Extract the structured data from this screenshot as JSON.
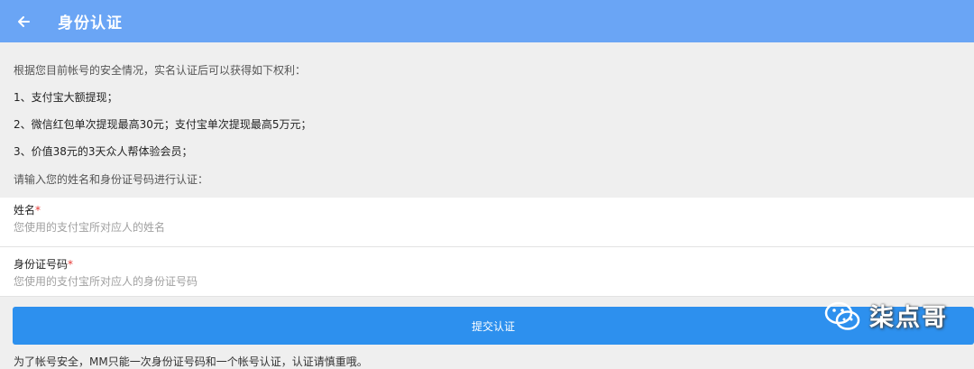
{
  "header": {
    "title": "身份认证",
    "back_icon": "arrow-left-icon",
    "background": "#6aa5f5"
  },
  "intro": {
    "lead": "根据您目前帐号的安全情况，实名认证后可以获得如下权利：",
    "benefits": [
      "1、支付宝大额提现；",
      "2、微信红包单次提现最高30元；支付宝单次提现最高5万元；",
      "3、价值38元的3天众人帮体验会员；"
    ],
    "hint": "请输入您的姓名和身份证号码进行认证："
  },
  "form": {
    "name": {
      "label": "姓名",
      "required_mark": "*",
      "placeholder": "您使用的支付宝所对应人的姓名"
    },
    "id_number": {
      "label": "身份证号码",
      "required_mark": "*",
      "placeholder": "您使用的支付宝所对应人的身份证号码"
    }
  },
  "submit_label": "提交认证",
  "submit_color": "#2d90ee",
  "footer_text": "为了帐号安全，MM只能一次身份证号码和一个帐号认证，认证请慎重哦。",
  "watermark": {
    "text": "柒点哥",
    "icon": "wechat-icon"
  }
}
